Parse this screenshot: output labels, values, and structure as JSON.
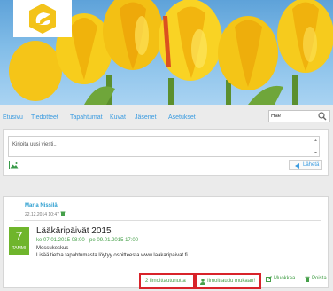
{
  "nav": {
    "items": [
      "Etusivu",
      "Tiedotteet",
      "Tapahtumat",
      "Kuvat",
      "Jäsenet",
      "Asetukset"
    ]
  },
  "search": {
    "value": "Hae"
  },
  "compose": {
    "placeholder": "Kirjoita uusi viesti..",
    "send_label": "Lähetä"
  },
  "post": {
    "author": "Maria Nissilä",
    "timestamp": "22.12.2014 10:47",
    "event": {
      "day": "7",
      "month": "TAMMI",
      "title": "Lääkäripäivät 2015",
      "dates": "ke 07.01.2015 08:00 - pe 09.01.2015 17:00",
      "location": "Messukeskus",
      "description": "Lisää tietoa tapahtumasta löytyy osoitteesta www.laakaripaivat.fi"
    },
    "actions": {
      "registered": "2 ilmoittautunutta",
      "join": "Ilmoittaudu mukaan!",
      "edit": "Muokkaa",
      "delete": "Poista"
    }
  },
  "colors": {
    "link": "#3a9be0",
    "green": "#46a04a",
    "badge": "#6fb52c",
    "highlight": "#d8232a"
  },
  "icons": [
    "logo-icon",
    "search-icon",
    "image-icon",
    "send-icon",
    "calendar-icon",
    "user-icon",
    "edit-icon",
    "trash-icon"
  ]
}
